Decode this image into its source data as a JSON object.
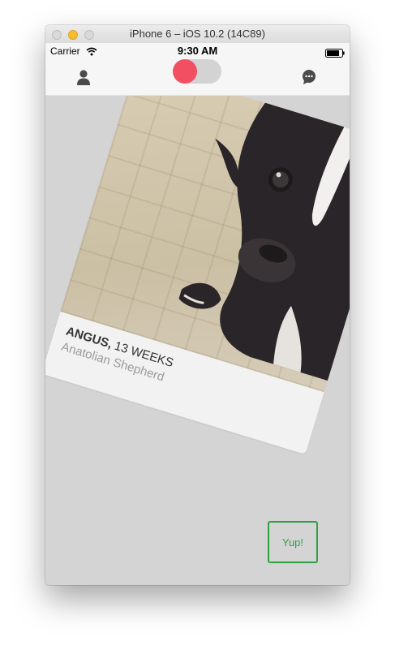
{
  "window": {
    "title": "iPhone 6 – iOS 10.2 (14C89)"
  },
  "status_bar": {
    "carrier": "Carrier",
    "time": "9:30 AM"
  },
  "nav": {
    "profile_icon": "person-icon",
    "toggle_state": "on",
    "chat_icon": "chat-bubble-icon"
  },
  "card": {
    "name": "ANGUS,",
    "age": "13 WEEKS",
    "breed": "Anatolian Shepherd"
  },
  "actions": {
    "yup_label": "Yup!"
  },
  "colors": {
    "toggle_knob": "#f25062",
    "yup_accent": "#2ea043",
    "background": "#d4d4d4"
  }
}
